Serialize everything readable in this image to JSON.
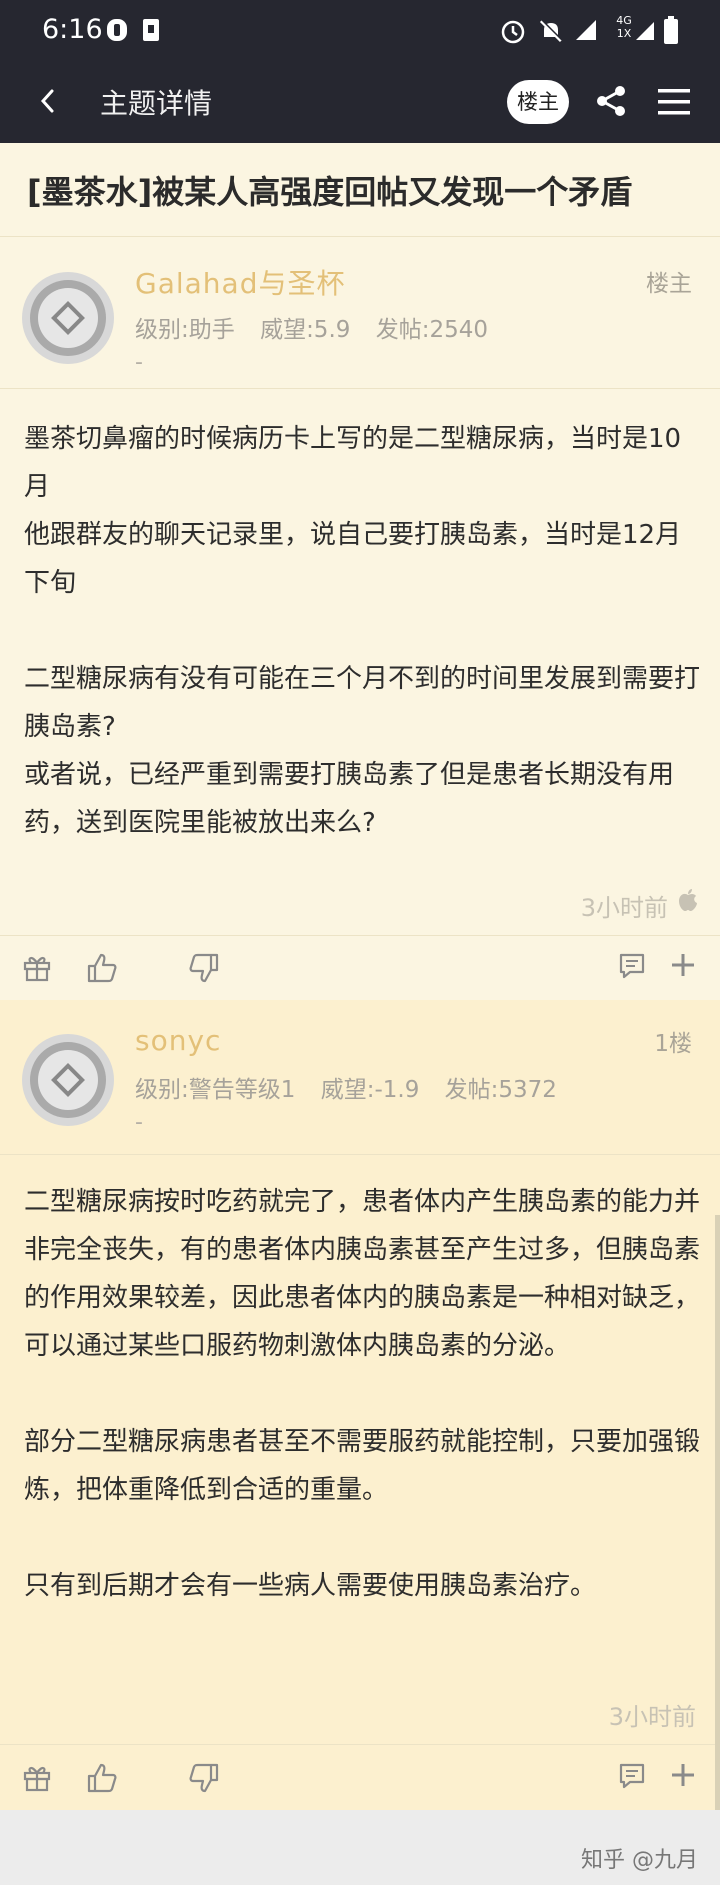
{
  "status_bar": {
    "time": "6:16",
    "icons": [
      "notification-icon",
      "sim-icon",
      "alarm-icon",
      "mute-icon",
      "signal-icon",
      "network-4g-icon",
      "battery-icon"
    ],
    "network_label_top": "4G",
    "network_label_bottom": "1X"
  },
  "app_bar": {
    "title": "主题详情",
    "owner_only_label": "楼主"
  },
  "thread": {
    "title": "[墨茶水]被某人高强度回帖又发现一个矛盾"
  },
  "posts": [
    {
      "author": "Galahad与圣杯",
      "level": "级别:助手",
      "prestige": "威望:5.9",
      "post_count": "发帖:2540",
      "signature": "-",
      "floor": "楼主",
      "paragraphs": [
        "墨茶切鼻瘤的时候病历卡上写的是二型糖尿病，当时是10月",
        "他跟群友的聊天记录里，说自己要打胰岛素，当时是12月下旬",
        "",
        "二型糖尿病有没有可能在三个月不到的时间里发展到需要打胰岛素?",
        "或者说，已经严重到需要打胰岛素了但是患者长期没有用药，送到医院里能被放出来么?"
      ],
      "time": "3小时前"
    },
    {
      "author": "sonyc",
      "level": "级别:警告等级1",
      "prestige": "威望:-1.9",
      "post_count": "发帖:5372",
      "signature": "-",
      "floor": "1楼",
      "paragraphs": [
        "二型糖尿病按时吃药就完了，患者体内产生胰岛素的能力并非完全丧失，有的患者体内胰岛素甚至产生过多，但胰岛素的作用效果较差，因此患者体内的胰岛素是一种相对缺乏，可以通过某些口服药物刺激体内胰岛素的分泌。",
        "",
        "部分二型糖尿病患者甚至不需要服药就能控制，只要加强锻炼，把体重降低到合适的重量。",
        "",
        "只有到后期才会有一些病人需要使用胰岛素治疗。"
      ],
      "time": "3小时前"
    }
  ],
  "watermark": "知乎 @九月",
  "colors": {
    "bar_bg": "#262730",
    "page_bg": "#fbf5e1",
    "author": "#e3c078",
    "meta": "#a6a29a",
    "text": "#2d2d2d"
  }
}
